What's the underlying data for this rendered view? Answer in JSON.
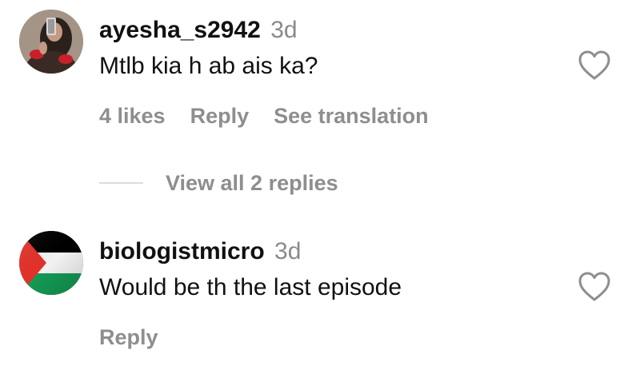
{
  "comments": [
    {
      "username": "ayesha_s2942",
      "time": "3d",
      "text": "Mtlb kia h ab ais ka?",
      "likes": "4 likes",
      "reply": "Reply",
      "translation": "See translation",
      "view_replies": "View all 2 replies",
      "avatar_icon": "profile-photo-icon",
      "like_icon": "heart-outline-icon"
    },
    {
      "username": "biologistmicro",
      "time": "3d",
      "text": "Would be th the last episode",
      "reply": "Reply",
      "avatar_icon": "palestine-flag-icon",
      "like_icon": "heart-outline-icon"
    }
  ],
  "colors": {
    "text": "#111111",
    "muted": "#8e8e8e",
    "divider": "#dbdbdb",
    "flag_red": "#e4312b",
    "flag_green": "#149954",
    "flag_black": "#000000",
    "flag_white": "#ffffff"
  }
}
